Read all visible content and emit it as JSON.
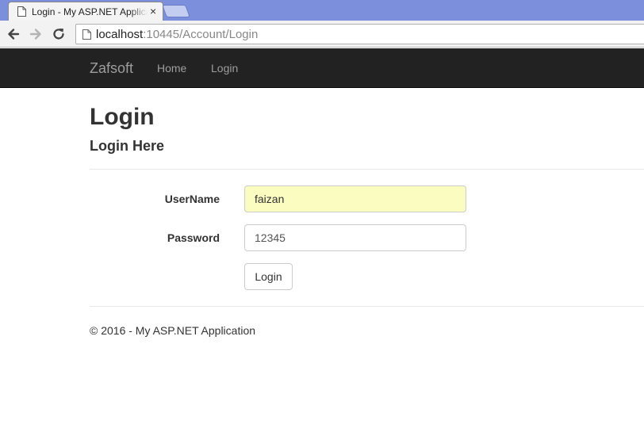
{
  "browser": {
    "tab_title": "Login - My ASP.NET Application",
    "url_host": "localhost",
    "url_rest": ":10445/Account/Login",
    "close_glyph": "×"
  },
  "site": {
    "brand": "Zafsoft",
    "nav": [
      {
        "label": "Home"
      },
      {
        "label": "Login"
      }
    ]
  },
  "page": {
    "heading": "Login",
    "subheading": "Login Here"
  },
  "form": {
    "username_label": "UserName",
    "username_value": "faizan",
    "password_label": "Password",
    "password_value": "12345",
    "submit_label": "Login"
  },
  "footer": {
    "text": "© 2016 - My ASP.NET Application"
  },
  "colors": {
    "tabstrip": "#7b8fdc",
    "navbar": "#222222",
    "autofill": "#fafcc0"
  },
  "icons": [
    "document-icon",
    "back-arrow-icon",
    "forward-arrow-icon",
    "reload-icon",
    "close-icon"
  ]
}
